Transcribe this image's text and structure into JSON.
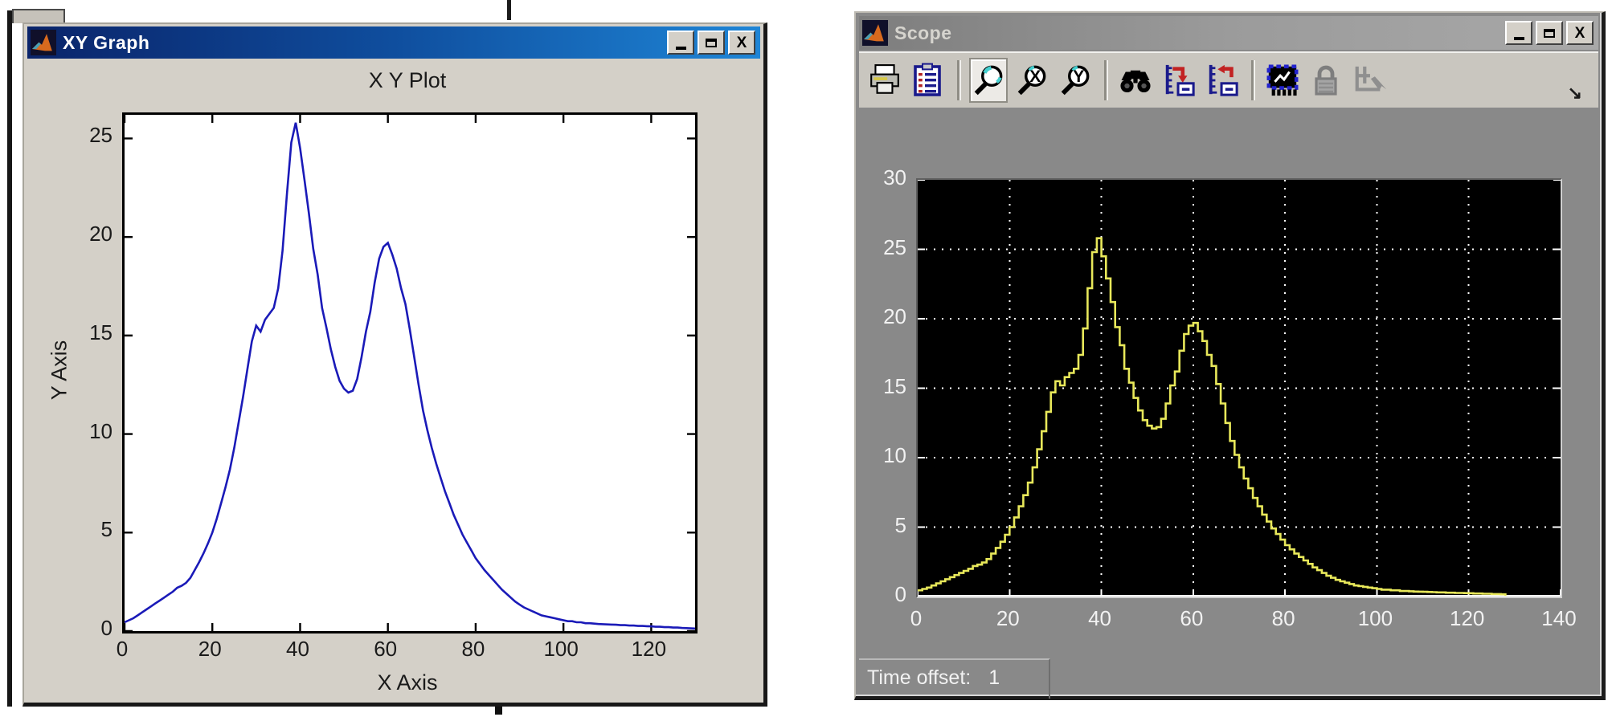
{
  "background": "#ffffff",
  "xy_window": {
    "title": "XY Graph",
    "icon": "matlab-logo",
    "window_buttons": [
      "minimize",
      "maximize",
      "close"
    ],
    "plot_title": "X Y Plot",
    "xlabel": "X Axis",
    "ylabel": "Y Axis",
    "x_tick_labels": [
      "0",
      "20",
      "40",
      "60",
      "80",
      "100",
      "120"
    ],
    "y_tick_labels": [
      "0",
      "5",
      "10",
      "15",
      "20",
      "25"
    ]
  },
  "scope_window": {
    "title": "Scope",
    "icon": "matlab-logo",
    "window_buttons": [
      "minimize",
      "maximize",
      "close"
    ],
    "toolbar": [
      "print",
      "parameters",
      "zoom",
      "zoom-x-axis",
      "zoom-y-axis",
      "autoscale",
      "save-axes-settings",
      "restore-axes-settings",
      "floating-scope",
      "lock-axes",
      "signal-selection",
      "overflow-arrow"
    ],
    "active_tool": "zoom",
    "x_tick_labels": [
      "0",
      "20",
      "40",
      "60",
      "80",
      "100",
      "120",
      "140"
    ],
    "y_tick_labels": [
      "0",
      "5",
      "10",
      "15",
      "20",
      "25",
      "30"
    ],
    "status_label": "Time offset:",
    "status_value": "1"
  },
  "colors": {
    "active_titlebar_start": "#0a246a",
    "active_titlebar_end": "#1e85d6",
    "inactive_titlebar": "#8c8c8c",
    "chrome_gray": "#d4d0c8",
    "scope_gray": "#898989",
    "toolbar_gray": "#c9c6bf",
    "xy_line": "#1a1ab8",
    "scope_line": "#e8e85a",
    "scope_bg": "#000000",
    "scope_grid": "#ffffff"
  },
  "chart_data": [
    {
      "type": "line",
      "title": "X Y Plot",
      "xlabel": "X Axis",
      "ylabel": "Y Axis",
      "xlim": [
        0,
        130
      ],
      "ylim": [
        0,
        26.2
      ],
      "x_ticks": [
        0,
        20,
        40,
        60,
        80,
        100,
        120
      ],
      "y_ticks": [
        0,
        5,
        10,
        15,
        20,
        25
      ],
      "grid": false,
      "bg": "#ffffff",
      "line_color": "#1a1ab8",
      "x_start": 0,
      "x_step": 1,
      "values": [
        0.45,
        0.55,
        0.65,
        0.8,
        0.95,
        1.1,
        1.25,
        1.4,
        1.55,
        1.7,
        1.85,
        2,
        2.2,
        2.3,
        2.45,
        2.7,
        3.1,
        3.5,
        3.95,
        4.45,
        5,
        5.7,
        6.5,
        7.3,
        8.2,
        9.3,
        10.6,
        11.9,
        13.3,
        14.7,
        15.5,
        15.2,
        15.8,
        16.1,
        16.4,
        17.4,
        19.3,
        22.2,
        24.8,
        25.8,
        24.5,
        22.9,
        21.2,
        19.4,
        18.1,
        16.4,
        15.4,
        14.3,
        13.4,
        12.7,
        12.3,
        12.1,
        12.2,
        12.8,
        13.9,
        15.2,
        16.2,
        17.7,
        18.9,
        19.5,
        19.7,
        19.1,
        18.4,
        17.4,
        16.6,
        15.3,
        13.9,
        12.5,
        11.2,
        10.2,
        9.3,
        8.5,
        7.8,
        7.1,
        6.5,
        5.9,
        5.4,
        4.9,
        4.5,
        4.1,
        3.7,
        3.4,
        3.1,
        2.85,
        2.6,
        2.35,
        2.1,
        1.9,
        1.7,
        1.5,
        1.35,
        1.2,
        1.1,
        1,
        0.9,
        0.8,
        0.75,
        0.7,
        0.65,
        0.6,
        0.55,
        0.5,
        0.5,
        0.45,
        0.45,
        0.4,
        0.4,
        0.38,
        0.36,
        0.35,
        0.34,
        0.33,
        0.32,
        0.3,
        0.3,
        0.28,
        0.28,
        0.26,
        0.26,
        0.25,
        0.24,
        0.22,
        0.22,
        0.2,
        0.2,
        0.18,
        0.18,
        0.16,
        0.15,
        0.14,
        0.13
      ]
    },
    {
      "type": "line",
      "style": "staircase",
      "title": "",
      "xlabel": "",
      "ylabel": "",
      "xlim": [
        0,
        140
      ],
      "ylim": [
        0,
        30
      ],
      "x_ticks": [
        0,
        20,
        40,
        60,
        80,
        100,
        120,
        140
      ],
      "y_ticks": [
        0,
        5,
        10,
        15,
        20,
        25,
        30
      ],
      "grid": true,
      "grid_style": "dotted",
      "grid_color": "#ffffff",
      "bg": "#000000",
      "line_color": "#e8e85a",
      "status_text": "Time offset: 1",
      "x_start": 0,
      "x_step": 1,
      "values": [
        0.45,
        0.55,
        0.65,
        0.8,
        0.95,
        1.1,
        1.25,
        1.4,
        1.55,
        1.7,
        1.85,
        2,
        2.2,
        2.3,
        2.45,
        2.7,
        3.1,
        3.5,
        3.95,
        4.45,
        5,
        5.7,
        6.5,
        7.3,
        8.2,
        9.3,
        10.6,
        11.9,
        13.3,
        14.7,
        15.5,
        15.2,
        15.8,
        16.1,
        16.4,
        17.4,
        19.3,
        22.2,
        24.8,
        25.8,
        24.5,
        22.9,
        21.2,
        19.4,
        18.1,
        16.4,
        15.4,
        14.3,
        13.4,
        12.7,
        12.3,
        12.1,
        12.2,
        12.8,
        13.9,
        15.2,
        16.2,
        17.7,
        18.9,
        19.5,
        19.7,
        19.1,
        18.4,
        17.4,
        16.6,
        15.3,
        13.9,
        12.5,
        11.2,
        10.2,
        9.3,
        8.5,
        7.8,
        7.1,
        6.5,
        5.9,
        5.4,
        4.9,
        4.5,
        4.1,
        3.7,
        3.4,
        3.1,
        2.85,
        2.6,
        2.35,
        2.1,
        1.9,
        1.7,
        1.5,
        1.35,
        1.2,
        1.1,
        1,
        0.9,
        0.8,
        0.75,
        0.7,
        0.65,
        0.6,
        0.55,
        0.5,
        0.5,
        0.45,
        0.45,
        0.4,
        0.4,
        0.38,
        0.36,
        0.35,
        0.34,
        0.33,
        0.32,
        0.3,
        0.3,
        0.28,
        0.28,
        0.26,
        0.26,
        0.25,
        0.24,
        0.22,
        0.22,
        0.2,
        0.2,
        0.18,
        0.18,
        0.16,
        0.15
      ]
    }
  ]
}
